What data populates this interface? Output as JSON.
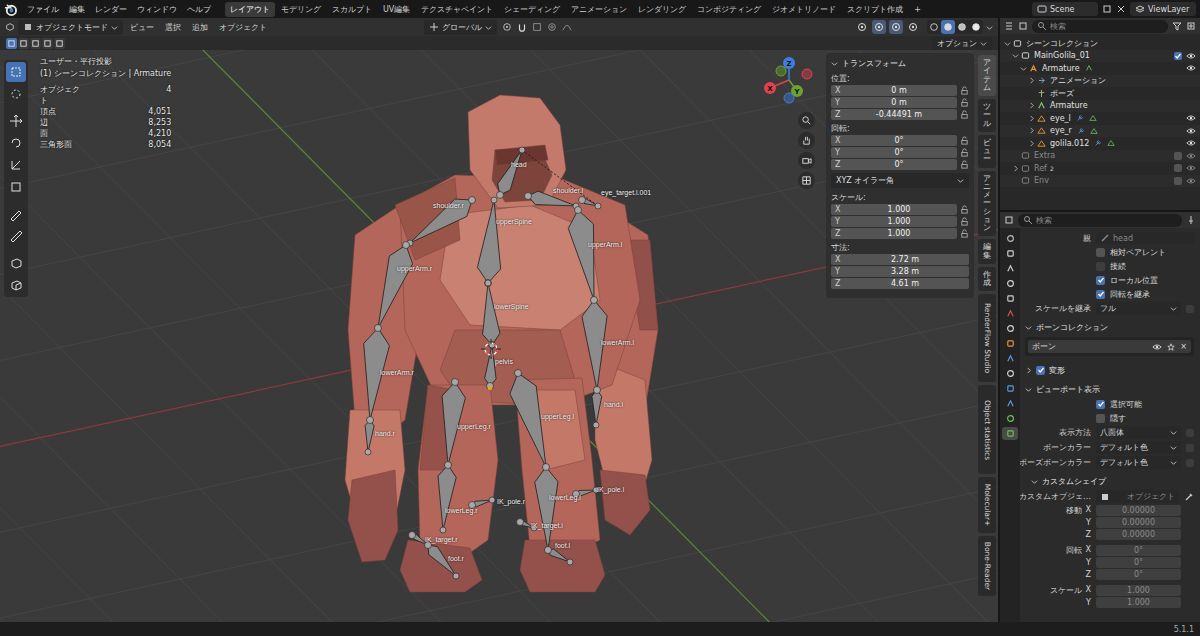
{
  "top_bar": {
    "menus": [
      "ファイル",
      "編集",
      "レンダー",
      "ウィンドウ",
      "ヘルプ"
    ],
    "workspaces": [
      {
        "label": "レイアウト",
        "selected": true
      },
      {
        "label": "モデリング",
        "selected": false
      },
      {
        "label": "スカルプト",
        "selected": false
      },
      {
        "label": "UV編集",
        "selected": false
      },
      {
        "label": "テクスチャペイント",
        "selected": false
      },
      {
        "label": "シェーディング",
        "selected": false
      },
      {
        "label": "アニメーション",
        "selected": false
      },
      {
        "label": "レンダリング",
        "selected": false
      },
      {
        "label": "コンポジティング",
        "selected": false
      },
      {
        "label": "ジオメトリノード",
        "selected": false
      },
      {
        "label": "スクリプト作成",
        "selected": false
      }
    ],
    "add_workspace": "+",
    "scene": "Scene",
    "view_layer": "ViewLayer"
  },
  "viewport": {
    "header": {
      "mode": "オブジェクトモード",
      "menus": [
        "ビュー",
        "選択",
        "追加",
        "オブジェクト"
      ],
      "orientation": "グローバル",
      "toggles": [
        {
          "on": false
        },
        {
          "on": true
        },
        {
          "on": true
        },
        {
          "on": false
        }
      ],
      "shading": [
        {
          "selected": false
        },
        {
          "selected": true
        },
        {
          "selected": false
        },
        {
          "selected": false
        }
      ]
    },
    "options": "オプション",
    "tools": [
      {
        "selected": true
      },
      {
        "selected": false
      },
      {
        "selected": false
      },
      {
        "selected": false
      },
      {
        "selected": false
      },
      {
        "selected": false
      },
      {
        "selected": false
      },
      {
        "selected": false
      },
      {
        "selected": false
      },
      {
        "selected": false
      }
    ],
    "info": {
      "view": "ユーザー・平行投影",
      "context": "(1) シーンコレクション | Armature",
      "stats": [
        {
          "label": "オブジェクト",
          "value": "4"
        },
        {
          "label": "頂点",
          "value": "4,051"
        },
        {
          "label": "辺",
          "value": "8,253"
        },
        {
          "label": "面",
          "value": "4,210"
        },
        {
          "label": "三角形面",
          "value": "8,054"
        }
      ]
    },
    "gizmo": [
      {
        "axis": "X",
        "color": "#e0414f"
      },
      {
        "axis": "Y",
        "color": "#6ba32e"
      },
      {
        "axis": "Z",
        "color": "#3d7fe0"
      }
    ],
    "bones": [
      "head",
      "shoulder.r",
      "shoulder.l",
      "eye_target.l.001",
      "upperSpine",
      "upperArm.r",
      "upperArm.l",
      "lowerSpine",
      "lowerArm.r",
      "lowerArm.l",
      "pelvis",
      "hand.r",
      "hand.l",
      "upperLeg.r",
      "upperLeg.l",
      "IK_pole.r",
      "IK_pole.l",
      "lowerLeg.r",
      "lowerLeg.l",
      "IK_target.r",
      "IK_target.l",
      "foot.r",
      "foot.l"
    ],
    "sidebar": {
      "title": "トランスフォーム",
      "expanded": true,
      "groups": [
        {
          "kind": "lockable",
          "label": "位置:",
          "fields": [
            {
              "axis": "X",
              "value": "0 m",
              "locked": false
            },
            {
              "axis": "Y",
              "value": "0 m",
              "locked": false
            },
            {
              "axis": "Z",
              "value": "-0.44491 m",
              "locked": false
            }
          ]
        },
        {
          "kind": "lockable",
          "label": "回転:",
          "fields": [
            {
              "axis": "X",
              "value": "0°",
              "locked": false
            },
            {
              "axis": "Y",
              "value": "0°",
              "locked": false
            },
            {
              "axis": "Z",
              "value": "0°",
              "locked": false
            }
          ]
        },
        {
          "kind": "select",
          "value": "XYZ オイラー角"
        },
        {
          "kind": "lockable",
          "label": "スケール:",
          "fields": [
            {
              "axis": "X",
              "value": "1.000",
              "locked": false
            },
            {
              "axis": "Y",
              "value": "1.000",
              "locked": false
            },
            {
              "axis": "Z",
              "value": "1.000",
              "locked": false
            }
          ]
        },
        {
          "kind": "plain",
          "label": "寸法:",
          "fields": [
            {
              "axis": "X",
              "value": "2.72 m"
            },
            {
              "axis": "Y",
              "value": "3.28 m"
            },
            {
              "axis": "Z",
              "value": "4.61 m"
            }
          ]
        }
      ]
    },
    "sidebar_tabs": [
      {
        "label": "アイテム",
        "kind": "vertical",
        "selected": true
      },
      {
        "label": "ツール",
        "kind": "vertical",
        "selected": false
      },
      {
        "label": "ビュー",
        "kind": "vertical",
        "selected": false
      },
      {
        "label": "アニメーション",
        "kind": "vertical",
        "selected": false
      },
      {
        "label": "編集",
        "kind": "vertical",
        "selected": false
      },
      {
        "label": "作成",
        "kind": "vertical",
        "selected": false
      },
      {
        "label": "RenderFlow Studio",
        "kind": "rotated",
        "selected": false
      },
      {
        "label": "Object statistics",
        "kind": "rotated",
        "selected": false
      },
      {
        "label": "Molecular+",
        "kind": "rotated",
        "selected": false
      },
      {
        "label": "Bone-Reader",
        "kind": "rotated",
        "selected": false
      }
    ]
  },
  "outliner": {
    "search_placeholder": "検索",
    "tree": {
      "label": "シーンコレクション",
      "kind": "scene-collection",
      "expandable": true,
      "expanded": true,
      "children": [
        {
          "label": "MainGolila_01",
          "kind": "collection",
          "expandable": true,
          "expanded": true,
          "checked": true,
          "visible": true,
          "children": [
            {
              "label": "Armature",
              "kind": "armature",
              "expandable": true,
              "expanded": true,
              "visible": true,
              "children": [
                {
                  "label": "アニメーション",
                  "kind": "animation",
                  "expandable": true,
                  "expanded": false
                },
                {
                  "label": "ポーズ",
                  "kind": "pose",
                  "expandable": false,
                  "expanded": false
                },
                {
                  "label": "Armature",
                  "kind": "armature-data",
                  "expandable": true,
                  "expanded": false
                },
                {
                  "label": "eye_l",
                  "kind": "mesh",
                  "expandable": true,
                  "expanded": false,
                  "visible": true
                },
                {
                  "label": "eye_r",
                  "kind": "mesh",
                  "expandable": true,
                  "expanded": false,
                  "visible": true
                },
                {
                  "label": "golila.012",
                  "kind": "mesh",
                  "expandable": true,
                  "expanded": false,
                  "visible": true
                }
              ]
            }
          ]
        },
        {
          "label": "Extra",
          "kind": "collection",
          "expandable": false,
          "expanded": false,
          "checked": false,
          "visible": true
        },
        {
          "label": "Ref",
          "kind": "collection",
          "expandable": true,
          "expanded": false,
          "checked": false,
          "visible": true,
          "badge": "2"
        },
        {
          "label": "Env",
          "kind": "collection",
          "expandable": false,
          "expanded": false,
          "checked": false,
          "visible": true
        }
      ]
    }
  },
  "properties": {
    "search_placeholder": "検索",
    "tabs": [
      {
        "selected": false
      },
      {
        "selected": false
      },
      {
        "selected": false
      },
      {
        "selected": false
      },
      {
        "selected": false
      },
      {
        "selected": false
      },
      {
        "selected": false
      },
      {
        "selected": false
      },
      {
        "selected": false
      },
      {
        "selected": false
      },
      {
        "selected": false
      },
      {
        "selected": false
      },
      {
        "selected": false
      },
      {
        "selected": true
      }
    ],
    "rows": [
      {
        "kind": "field",
        "label": "親",
        "value": "head",
        "disabled": true
      },
      {
        "kind": "check",
        "label": "相対ペアレント",
        "checked": false,
        "disabled": false
      },
      {
        "kind": "check",
        "label": "接続",
        "checked": false,
        "disabled": true
      },
      {
        "kind": "check",
        "label": "ローカル位置",
        "checked": true,
        "disabled": false
      },
      {
        "kind": "check",
        "label": "回転を継承",
        "checked": true,
        "disabled": false
      },
      {
        "kind": "select",
        "label": "スケールを継承",
        "value": "フル"
      },
      {
        "kind": "section",
        "label": "ボーンコレクション",
        "expanded": true
      },
      {
        "kind": "list",
        "items": [
          {
            "label": "ボーン",
            "visible": true,
            "remove": "×"
          }
        ]
      },
      {
        "kind": "section-check",
        "label": "変形",
        "expanded": false,
        "checked": true
      },
      {
        "kind": "section",
        "label": "ビューポート表示",
        "expanded": true
      },
      {
        "kind": "check",
        "label": "選択可能",
        "checked": true,
        "disabled": false
      },
      {
        "kind": "check",
        "label": "隠す",
        "checked": false,
        "disabled": false
      },
      {
        "kind": "select",
        "label": "表示方法",
        "value": "八面体"
      },
      {
        "kind": "select",
        "label": "ボーンカラー",
        "value": "デフォルト色"
      },
      {
        "kind": "select",
        "label": "ポーズボーンカラー",
        "value": "デフォルト色"
      },
      {
        "kind": "subsection",
        "label": "カスタムシェイプ",
        "expanded": true
      },
      {
        "kind": "object",
        "label": "カスタムオブジェ…",
        "placeholder": "オブジェクト"
      },
      {
        "kind": "vector",
        "label": "移動",
        "disabled": true,
        "fields": [
          {
            "axis": "X",
            "value": "0.00000"
          },
          {
            "axis": "Y",
            "value": "0.00000"
          },
          {
            "axis": "Z",
            "value": "0.00000"
          }
        ]
      },
      {
        "kind": "vector",
        "label": "回転",
        "disabled": true,
        "fields": [
          {
            "axis": "X",
            "value": "0°"
          },
          {
            "axis": "Y",
            "value": "0°"
          },
          {
            "axis": "Z",
            "value": "0°"
          }
        ]
      },
      {
        "kind": "vector",
        "label": "スケール",
        "disabled": true,
        "fields": [
          {
            "axis": "X",
            "value": "1.000"
          },
          {
            "axis": "Y",
            "value": "1.000"
          }
        ]
      }
    ]
  },
  "status_bar": {
    "version": "5.1.1"
  }
}
